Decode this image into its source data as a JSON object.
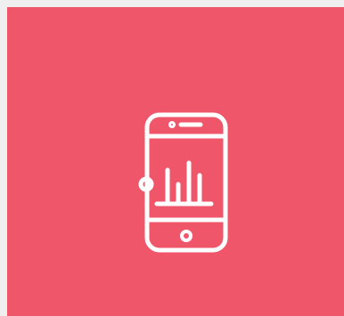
{
  "colors": {
    "page_background": "#efefef",
    "tile_background": "#f0566a",
    "icon_stroke": "#ffffff"
  },
  "tile": {
    "icon": "smartphone-analytics-icon"
  }
}
